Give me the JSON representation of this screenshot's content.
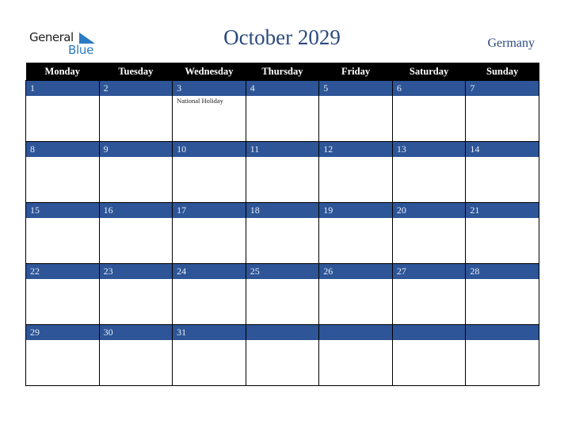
{
  "brand": {
    "general": "General",
    "blue": "Blue"
  },
  "title": "October 2029",
  "country": "Germany",
  "weekdays": [
    "Monday",
    "Tuesday",
    "Wednesday",
    "Thursday",
    "Friday",
    "Saturday",
    "Sunday"
  ],
  "weeks": [
    [
      {
        "day": "1",
        "event": ""
      },
      {
        "day": "2",
        "event": ""
      },
      {
        "day": "3",
        "event": "National Holiday"
      },
      {
        "day": "4",
        "event": ""
      },
      {
        "day": "5",
        "event": ""
      },
      {
        "day": "6",
        "event": ""
      },
      {
        "day": "7",
        "event": ""
      }
    ],
    [
      {
        "day": "8",
        "event": ""
      },
      {
        "day": "9",
        "event": ""
      },
      {
        "day": "10",
        "event": ""
      },
      {
        "day": "11",
        "event": ""
      },
      {
        "day": "12",
        "event": ""
      },
      {
        "day": "13",
        "event": ""
      },
      {
        "day": "14",
        "event": ""
      }
    ],
    [
      {
        "day": "15",
        "event": ""
      },
      {
        "day": "16",
        "event": ""
      },
      {
        "day": "17",
        "event": ""
      },
      {
        "day": "18",
        "event": ""
      },
      {
        "day": "19",
        "event": ""
      },
      {
        "day": "20",
        "event": ""
      },
      {
        "day": "21",
        "event": ""
      }
    ],
    [
      {
        "day": "22",
        "event": ""
      },
      {
        "day": "23",
        "event": ""
      },
      {
        "day": "24",
        "event": ""
      },
      {
        "day": "25",
        "event": ""
      },
      {
        "day": "26",
        "event": ""
      },
      {
        "day": "27",
        "event": ""
      },
      {
        "day": "28",
        "event": ""
      }
    ],
    [
      {
        "day": "29",
        "event": ""
      },
      {
        "day": "30",
        "event": ""
      },
      {
        "day": "31",
        "event": ""
      },
      {
        "day": "",
        "event": ""
      },
      {
        "day": "",
        "event": ""
      },
      {
        "day": "",
        "event": ""
      },
      {
        "day": "",
        "event": ""
      }
    ]
  ],
  "colors": {
    "band": "#2d5597",
    "header": "#000000",
    "title": "#2b4a7e",
    "logo_blue": "#2a7bc4"
  }
}
